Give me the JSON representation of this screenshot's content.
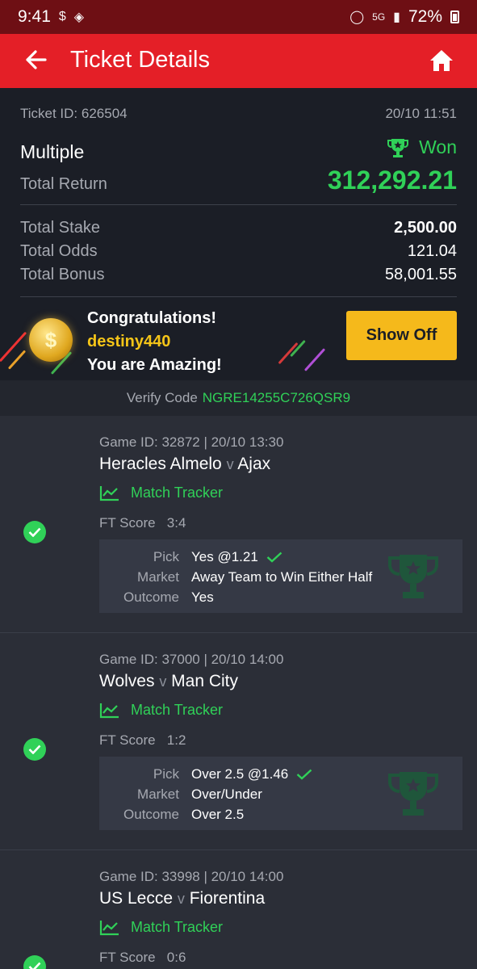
{
  "status_bar": {
    "time": "9:41",
    "battery": "72%",
    "network": "5G"
  },
  "app_bar": {
    "title": "Ticket Details"
  },
  "ticket": {
    "id_label": "Ticket ID: 626504",
    "datetime": "20/10 11:51",
    "type": "Multiple",
    "status": "Won",
    "total_return_label": "Total Return",
    "total_return": "312,292.21",
    "total_stake_label": "Total Stake",
    "total_stake": "2,500.00",
    "total_odds_label": "Total Odds",
    "total_odds": "121.04",
    "total_bonus_label": "Total Bonus",
    "total_bonus": "58,001.55"
  },
  "promo": {
    "line1": "Congratulations!",
    "username": "destiny440",
    "line3": "You are Amazing!",
    "button": "Show Off"
  },
  "verify": {
    "label": "Verify Code",
    "code": "NGRE14255C726QSR9"
  },
  "games": [
    {
      "meta": "Game ID: 32872 | 20/10 13:30",
      "home": "Heracles Almelo",
      "vs": "v",
      "away": "Ajax",
      "tracker": "Match Tracker",
      "ft_label": "FT Score",
      "ft_score": "3:4",
      "pick_label": "Pick",
      "pick": "Yes @1.21",
      "market_label": "Market",
      "market": "Away Team to Win Either Half",
      "outcome_label": "Outcome",
      "outcome": "Yes"
    },
    {
      "meta": "Game ID: 37000 | 20/10 14:00",
      "home": "Wolves",
      "vs": "v",
      "away": "Man City",
      "tracker": "Match Tracker",
      "ft_label": "FT Score",
      "ft_score": "1:2",
      "pick_label": "Pick",
      "pick": "Over 2.5 @1.46",
      "market_label": "Market",
      "market": "Over/Under",
      "outcome_label": "Outcome",
      "outcome": "Over 2.5"
    },
    {
      "meta": "Game ID: 33998 | 20/10 14:00",
      "home": "US Lecce",
      "vs": "v",
      "away": "Fiorentina",
      "tracker": "Match Tracker",
      "ft_label": "FT Score",
      "ft_score": "0:6"
    }
  ],
  "colors": {
    "brand_red": "#e41f27",
    "win_green": "#30d158",
    "accent_yellow": "#f5b91b"
  }
}
